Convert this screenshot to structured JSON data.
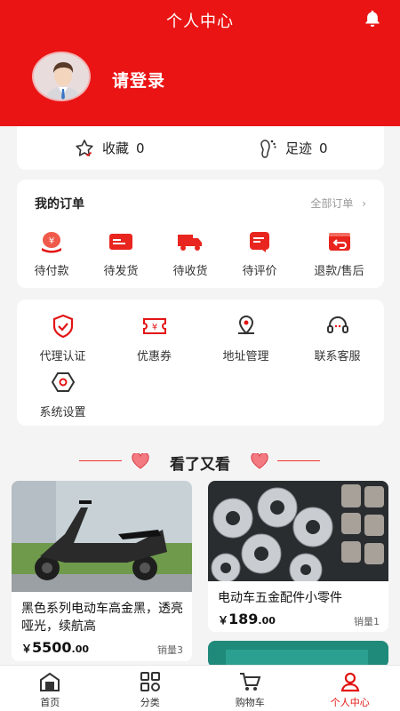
{
  "header": {
    "title": "个人中心",
    "login_text": "请登录"
  },
  "stats": {
    "favorites_label": "收藏",
    "favorites_count": "0",
    "footprints_label": "足迹",
    "footprints_count": "0"
  },
  "orders": {
    "title": "我的订单",
    "all_label": "全部订单",
    "items": [
      {
        "label": "待付款",
        "icon": "pay-icon"
      },
      {
        "label": "待发货",
        "icon": "ship-icon"
      },
      {
        "label": "待收货",
        "icon": "truck-icon"
      },
      {
        "label": "待评价",
        "icon": "review-icon"
      },
      {
        "label": "退款/售后",
        "icon": "refund-icon"
      }
    ]
  },
  "services": [
    {
      "label": "代理认证",
      "icon": "shield-icon"
    },
    {
      "label": "优惠券",
      "icon": "coupon-icon"
    },
    {
      "label": "地址管理",
      "icon": "location-icon"
    },
    {
      "label": "联系客服",
      "icon": "headset-icon"
    },
    {
      "label": "系统设置",
      "icon": "settings-icon"
    }
  ],
  "recommend": {
    "title": "看了又看",
    "products": [
      {
        "name": "黑色系列电动车高金黑，透亮哑光，续航高",
        "currency": "￥",
        "price_int": "5500",
        "price_dec": ".00",
        "sales": "销量3"
      },
      {
        "name": "电动车五金配件小零件",
        "currency": "￥",
        "price_int": "189",
        "price_dec": ".00",
        "sales": "销量1"
      }
    ]
  },
  "tabbar": [
    {
      "label": "首页",
      "icon": "home-icon"
    },
    {
      "label": "分类",
      "icon": "category-icon"
    },
    {
      "label": "购物车",
      "icon": "cart-icon"
    },
    {
      "label": "个人中心",
      "icon": "user-icon"
    }
  ],
  "colors": {
    "brand_red": "#ea1414",
    "accent_red": "#e31414"
  }
}
